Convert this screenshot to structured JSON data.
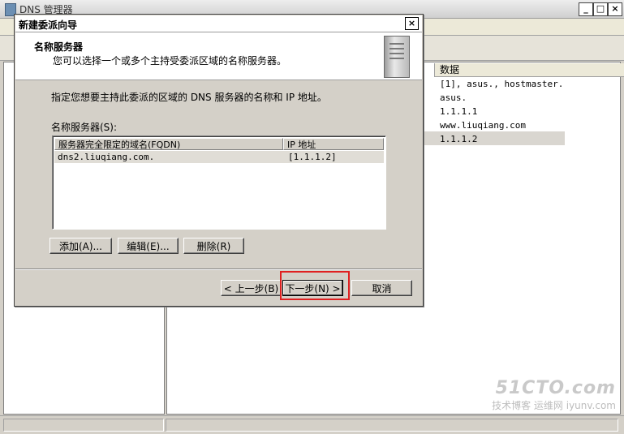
{
  "bg_window": {
    "title": "DNS 管理器",
    "min_glyph": "_",
    "max_glyph": "□",
    "close_glyph": "×"
  },
  "records": {
    "column_header": "数据",
    "rows": [
      "[1], asus., hostmaster.",
      "asus.",
      "1.1.1.1",
      "www.liuqiang.com",
      "1.1.1.2"
    ]
  },
  "dialog": {
    "title": "新建委派向导",
    "close_glyph": "×",
    "header_title": "名称服务器",
    "header_subtitle": "您可以选择一个或多个主持受委派区域的名称服务器。",
    "instruction": "指定您想要主持此委派的区域的 DNS 服务器的名称和 IP 地址。",
    "ns_label": "名称服务器(S):",
    "columns": [
      "服务器完全限定的域名(FQDN)",
      "IP 地址"
    ],
    "servers": [
      {
        "fqdn": "dns2.liuqiang.com.",
        "ip": "[1.1.1.2]"
      }
    ],
    "buttons": {
      "add": "添加(A)...",
      "edit": "编辑(E)...",
      "delete": "删除(R)",
      "back": "< 上一步(B)",
      "next": "下一步(N) >",
      "cancel": "取消"
    }
  },
  "watermark": {
    "line1": "51CTO.com",
    "line2": "技术博客 运维网 iyunv.com"
  }
}
